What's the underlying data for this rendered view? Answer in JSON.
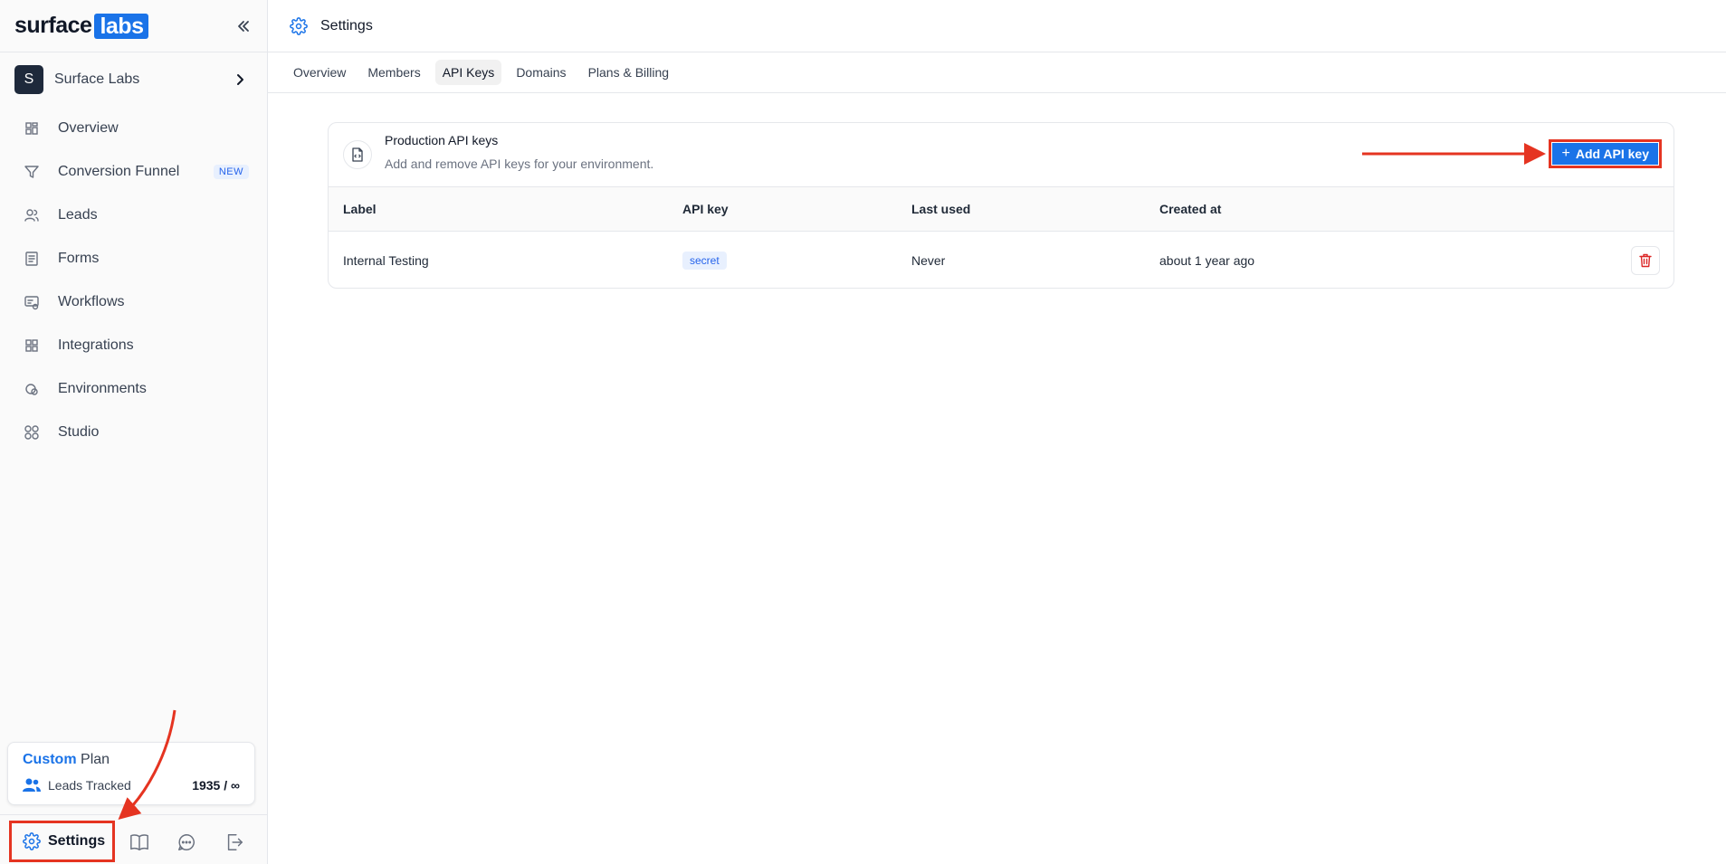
{
  "sidebar": {
    "logo": {
      "part1": "surface",
      "part2": "labs"
    },
    "org": {
      "initial": "S",
      "name": "Surface Labs"
    },
    "nav": [
      {
        "label": "Overview",
        "icon": "grid-icon"
      },
      {
        "label": "Conversion Funnel",
        "icon": "funnel-icon",
        "badge": "NEW"
      },
      {
        "label": "Leads",
        "icon": "users-icon"
      },
      {
        "label": "Forms",
        "icon": "form-icon"
      },
      {
        "label": "Workflows",
        "icon": "workflow-icon"
      },
      {
        "label": "Integrations",
        "icon": "integrations-icon"
      },
      {
        "label": "Environments",
        "icon": "environments-icon"
      },
      {
        "label": "Studio",
        "icon": "studio-icon"
      }
    ],
    "plan": {
      "name": "Custom",
      "suffix": "Plan",
      "metric_label": "Leads Tracked",
      "metric_value": "1935 / ∞"
    },
    "bottom": {
      "settings_label": "Settings"
    }
  },
  "header": {
    "title": "Settings"
  },
  "tabs": [
    {
      "label": "Overview",
      "active": false
    },
    {
      "label": "Members",
      "active": false
    },
    {
      "label": "API Keys",
      "active": true
    },
    {
      "label": "Domains",
      "active": false
    },
    {
      "label": "Plans & Billing",
      "active": false
    }
  ],
  "api_keys": {
    "title": "Production API keys",
    "subtitle": "Add and remove API keys for your environment.",
    "add_button": "Add API key",
    "columns": [
      "Label",
      "API key",
      "Last used",
      "Created at"
    ],
    "rows": [
      {
        "label": "Internal Testing",
        "key": "secret",
        "last_used": "Never",
        "created_at": "about 1 year ago"
      }
    ]
  },
  "colors": {
    "accent": "#1a73e8",
    "annotation": "#e53421",
    "delete": "#dc2626"
  }
}
